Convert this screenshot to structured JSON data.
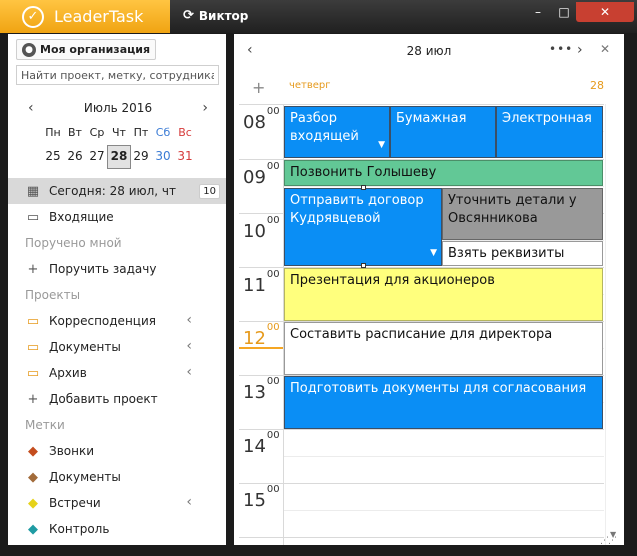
{
  "app": {
    "name": "LeaderTask",
    "user": "Виктор"
  },
  "sidebar": {
    "org_button": "Моя организация",
    "search_placeholder": "Найти проект, метку, сотрудника...",
    "calendar": {
      "month": "Июль 2016",
      "weekdays": [
        "Пн",
        "Вт",
        "Ср",
        "Чт",
        "Пт",
        "Сб",
        "Вс"
      ],
      "days": [
        "25",
        "26",
        "27",
        "28",
        "29",
        "30",
        "31"
      ]
    },
    "today": "Сегодня: 28 июл, чт",
    "today_count": "10",
    "inbox": "Входящие",
    "section_assigned": "Поручено мной",
    "assign_task": "Поручить задачу",
    "section_projects": "Проекты",
    "projects": [
      "Корресподенция",
      "Документы",
      "Архив"
    ],
    "add_project": "Добавить проект",
    "section_tags": "Метки",
    "tags": [
      "Звонки",
      "Документы",
      "Встречи",
      "Контроль"
    ]
  },
  "calendar_panel": {
    "date": "28 июл",
    "day_name": "четверг",
    "day_num": "28",
    "hours": [
      "08",
      "09",
      "10",
      "11",
      "12",
      "13",
      "14",
      "15"
    ],
    "minutes": "00",
    "events": [
      "Разбор входящей",
      "Бумажная",
      "Электронная",
      "Позвонить Голышеву",
      "Отправить договор Кудрявцевой",
      "Уточнить детали у Овсянникова",
      "Взять реквизиты",
      "Презентация для акционеров",
      "Составить расписание для директора",
      "Подготовить документы для согласования"
    ]
  }
}
